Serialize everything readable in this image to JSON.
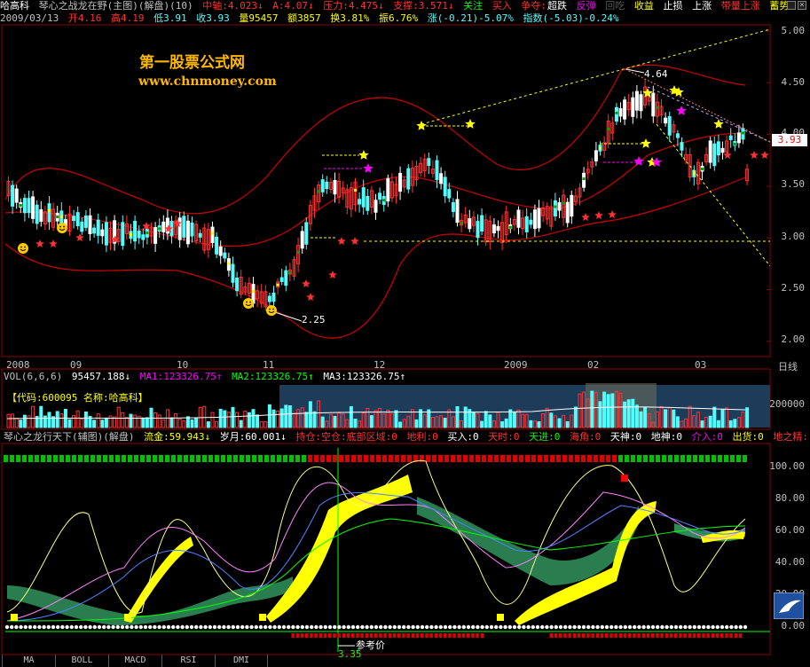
{
  "header": {
    "stock_name": "哈高科",
    "indicator_title": "琴心之战龙在野(主图)(解盘)(10)",
    "zhongxian": "中轴:4.023↓",
    "a_line": "A:4.07↓",
    "yali": "压力:4.475↓",
    "zhicheng": "支撑:3.571↓",
    "guanzhu": "关注",
    "mairu": "买入",
    "zhengduo": "争夺:",
    "chaodie": "超跌",
    "fantan": "反弹",
    "huiceng": "回吃",
    "shouyi": "收益",
    "zhisun": "止损",
    "shangzhang": "上涨",
    "dailiang": "带量上涨",
    "xuli": "蓄势"
  },
  "quote": {
    "date": "2009/03/13",
    "open": "开4.16",
    "high": "高4.19",
    "low": "低3.91",
    "close": "收3.93",
    "volume": "量95457",
    "amount": "额3857",
    "turnover": "换3.81%",
    "amplitude": "振6.76%",
    "change": "涨(-0.21)-5.07%",
    "index": "指数(-5.03)-0.24%"
  },
  "watermark": {
    "title": "第一股票公式网",
    "url": "www.chnmoney.com"
  },
  "main_chart": {
    "price_axis": [
      "5.00",
      "4.50",
      "4.00",
      "3.50",
      "3.00",
      "2.50",
      "2.00"
    ],
    "current_price": "3.93",
    "high_label": "4.64",
    "low_label": "2.25"
  },
  "time_axis": [
    "2008",
    "09",
    "10",
    "11",
    "12",
    "2009",
    "02",
    "03"
  ],
  "time_axis_mode": "日线",
  "volume_panel": {
    "title": "VOL(6,6,6)",
    "vol_value": "95457.188↓",
    "ma1": "MA1:123326.75↑",
    "ma2": "MA2:123326.75↑",
    "ma3": "MA3:123326.75↑",
    "code_label": "【代码:600095  名称:哈高科】",
    "axis_label": "200000"
  },
  "sub_panel": {
    "title": "琴心之龙行天下(辅图)(解盘)",
    "liujin": "流金:59.943↓",
    "suiyue": "岁月:60.001↓",
    "chicang": "持仓:空仓:底部区域:0",
    "dili": "地利:0",
    "mairu": "买入:0",
    "tianshi": "天时:0",
    "tianjin": "天进:0",
    "haijiao": "海角:0",
    "tianshen": "天神:0",
    "dishen": "地神:0",
    "jieru": "介入:0",
    "chuhuo": "出货:0",
    "dizhijing": "地之精:",
    "axis": [
      "100.00",
      "80.00",
      "60.00",
      "40.00",
      "20.00",
      "0.00"
    ],
    "ref_price": "3.35",
    "ref_label": "参考价"
  },
  "tabs": [
    "MA",
    "BOLL",
    "MACD",
    "RSI",
    "DMI"
  ],
  "colors": {
    "up": "#ff3232",
    "down": "#54fcfc",
    "yellow": "#ffff00",
    "magenta": "#ff00ff",
    "green": "#00a000"
  }
}
